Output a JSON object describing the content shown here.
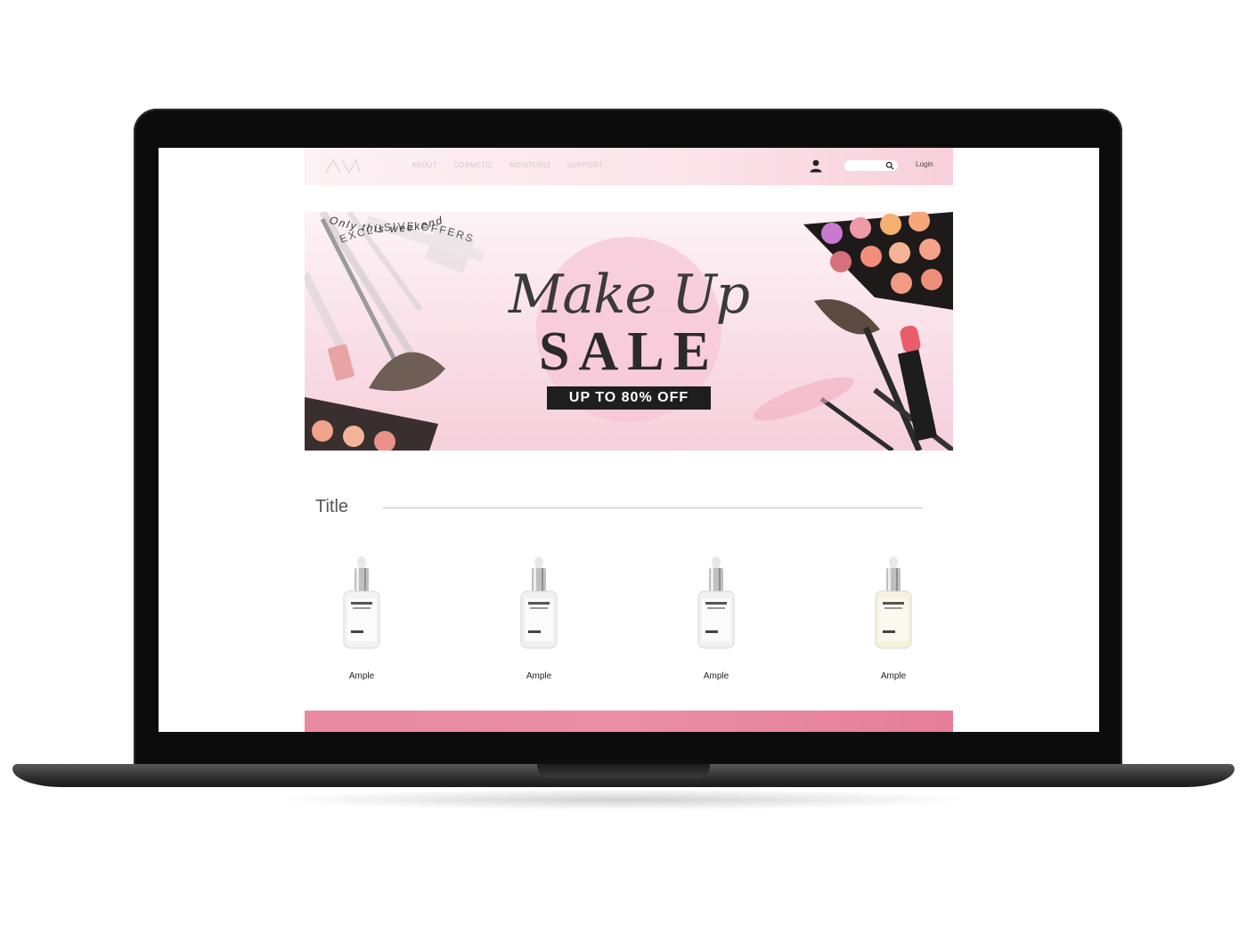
{
  "nav": {
    "links": [
      "ABOUT",
      "COSMETIC",
      "MOISTURIZ",
      "SUPPORT"
    ],
    "search_placeholder": "",
    "login": "Login"
  },
  "banner": {
    "exclusive": "EXCLUSIVE OFFERS",
    "headline": "Make Up",
    "sale": "SALE",
    "offer": "UP TO 80% OFF",
    "tagline": "Only this weekend"
  },
  "section": {
    "title": "Title"
  },
  "products": [
    {
      "name": "Ample",
      "liquid": "#f3f3f3"
    },
    {
      "name": "Ample",
      "liquid": "#f0f0f0"
    },
    {
      "name": "Ample",
      "liquid": "#f1f1f1"
    },
    {
      "name": "Ample",
      "liquid": "#f4f2dc"
    }
  ],
  "colors": {
    "brand_pink": "#f6cfdb",
    "accent_pink": "#e98aa2",
    "dark": "#1e1e1e"
  }
}
